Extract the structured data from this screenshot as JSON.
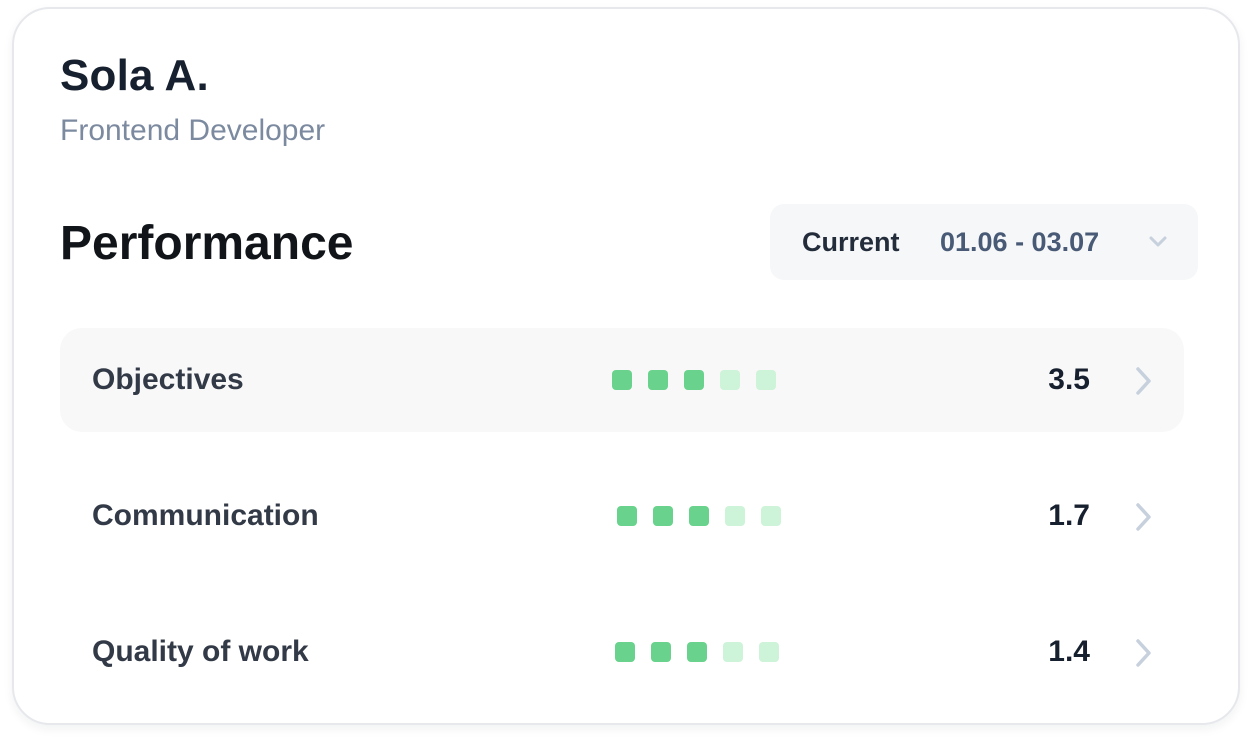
{
  "profile": {
    "name": "Sola A.",
    "role": "Frontend Developer"
  },
  "performance": {
    "title": "Performance",
    "period": {
      "label": "Current",
      "range": "01.06 - 03.07",
      "icon": "chevron-down-icon"
    },
    "metrics": [
      {
        "label": "Objectives",
        "score": "3.5",
        "filled": 3,
        "total": 5,
        "active": true
      },
      {
        "label": "Communication",
        "score": "1.7",
        "filled": 3,
        "total": 5,
        "active": false
      },
      {
        "label": "Quality of work",
        "score": "1.4",
        "filled": 3,
        "total": 5,
        "active": false
      }
    ]
  },
  "colors": {
    "dot_filled": "#69d28c",
    "dot_empty": "#cdf3d8",
    "chevron": "#c7d0dd",
    "active_row_bg": "#f8f8f8"
  }
}
